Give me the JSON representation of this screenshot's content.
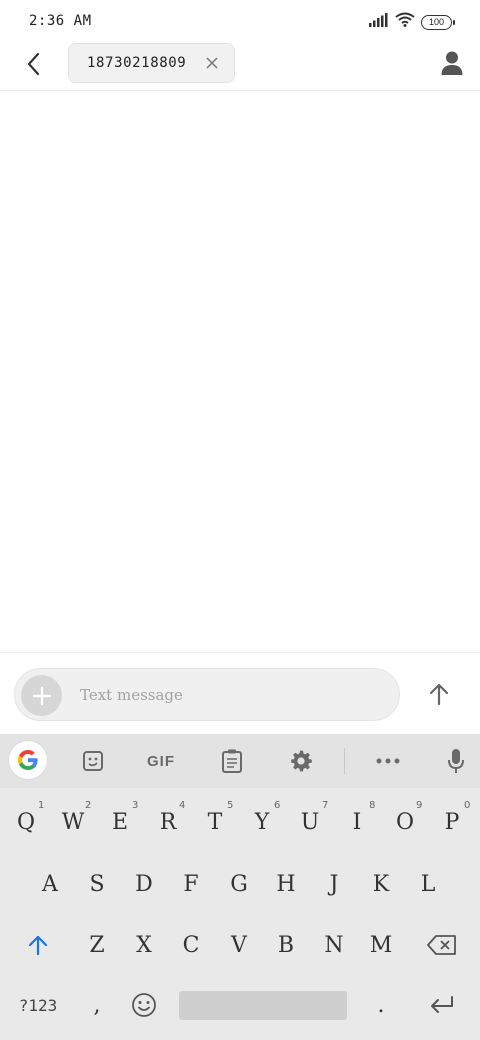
{
  "status_bar": {
    "time": "2:36 AM",
    "battery": "100",
    "icons": [
      "signal-icon",
      "wifi-icon",
      "battery-icon"
    ]
  },
  "header": {
    "back_icon": "back-arrow-icon",
    "recipient": "18730218809",
    "chip_close_icon": "close-icon",
    "contact_icon": "contact-person-icon"
  },
  "compose": {
    "add_icon": "plus-icon",
    "placeholder": "Text message",
    "value": "",
    "send_icon": "send-up-arrow-icon"
  },
  "keyboard": {
    "toolbar": {
      "items": [
        "google-icon",
        "sticker-icon",
        "GIF",
        "clipboard-icon",
        "gear-icon",
        "more-icon",
        "mic-icon"
      ],
      "gif_label": "GIF"
    },
    "row1": [
      {
        "label": "Q",
        "hint": "1"
      },
      {
        "label": "W",
        "hint": "2"
      },
      {
        "label": "E",
        "hint": "3"
      },
      {
        "label": "R",
        "hint": "4"
      },
      {
        "label": "T",
        "hint": "5"
      },
      {
        "label": "Y",
        "hint": "6"
      },
      {
        "label": "U",
        "hint": "7"
      },
      {
        "label": "I",
        "hint": "8"
      },
      {
        "label": "O",
        "hint": "9"
      },
      {
        "label": "P",
        "hint": "0"
      }
    ],
    "row2": [
      "A",
      "S",
      "D",
      "F",
      "G",
      "H",
      "J",
      "K",
      "L"
    ],
    "row3": [
      "Z",
      "X",
      "C",
      "V",
      "B",
      "N",
      "M"
    ],
    "row4": {
      "symbols": "?123",
      "comma": ",",
      "period": ".",
      "emoji_icon": "emoji-icon",
      "enter_icon": "enter-icon"
    },
    "shift_icon": "shift-icon",
    "backspace_icon": "backspace-icon",
    "colors": {
      "shift": "#1a73e8",
      "keyboard_bg": "#e9e9e9"
    }
  }
}
